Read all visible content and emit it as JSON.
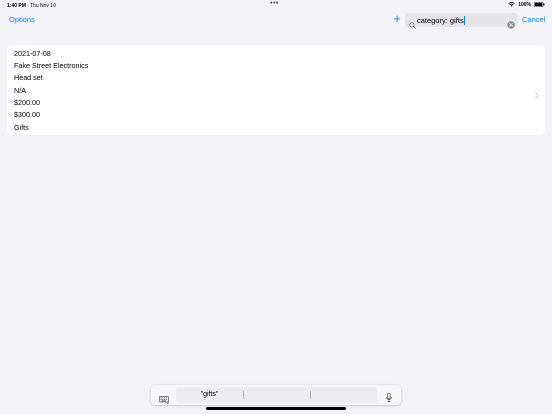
{
  "status_bar": {
    "time": "1:40 PM",
    "date": "Thu Nov 10",
    "multitask_dots": "•••",
    "battery_percent": "100%",
    "icons": [
      "wifi-icon",
      "battery-icon"
    ]
  },
  "nav": {
    "options_label": "Options",
    "add_label": "+",
    "search_value": "category: gifts",
    "cancel_label": "Cancel",
    "icons": [
      "search-icon",
      "clear-icon"
    ]
  },
  "result": {
    "date": "2021-07-08",
    "store": "Fake Street Electronics",
    "item": "Head set",
    "detail": "N/A",
    "price": "$200.00",
    "total": "$300.00",
    "category": "Gifts",
    "icons": [
      "chevron-right-icon"
    ]
  },
  "keyboard": {
    "suggestions": [
      "\"gifts\"",
      "",
      ""
    ],
    "icons": [
      "keyboard-icon",
      "microphone-icon"
    ]
  },
  "colors": {
    "accent": "#0a84ff",
    "background": "#f2f2f7",
    "card": "#ffffff"
  }
}
